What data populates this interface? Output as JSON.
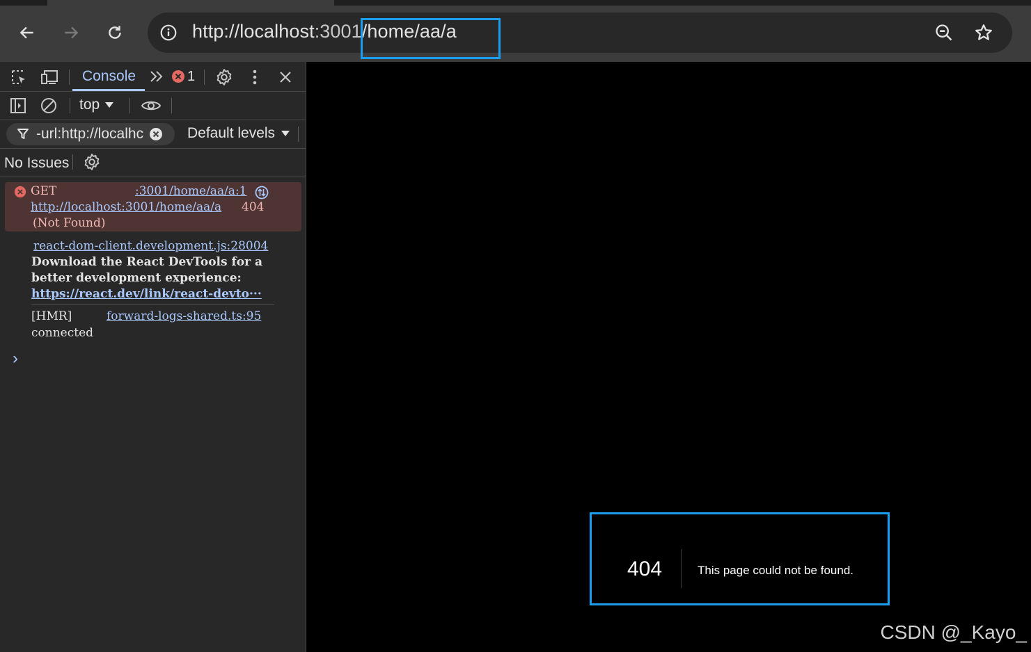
{
  "browser": {
    "url_host": "http://localhost",
    "url_port": ":3001",
    "url_path": "/home/aa/a"
  },
  "devtools": {
    "tabs": {
      "console": "Console",
      "error_count": "1"
    },
    "console_toolbar": {
      "context": "top"
    },
    "filter": {
      "value": "-url:http://localhc",
      "levels": "Default levels"
    },
    "issues": {
      "label": "No Issues"
    },
    "messages": [
      {
        "type": "error",
        "method": "GET",
        "source": ":3001/home/aa/a:1",
        "url": "http://localhost:3001/home/aa/a",
        "status": "404",
        "status_text": "(Not Found)"
      },
      {
        "type": "info",
        "source": "react-dom-client.development.js:28004",
        "line1": "Download the React DevTools for a",
        "line2": "better development experience:",
        "link": "https://react.dev/link/react-devto···"
      },
      {
        "type": "log",
        "prefix": "[HMR]",
        "source": "forward-logs-shared.ts:95",
        "text": "connected"
      }
    ],
    "prompt": "›"
  },
  "page": {
    "code": "404",
    "message": "This page could not be found."
  },
  "watermark": "CSDN @_Kayo_",
  "colors": {
    "accent": "#a8c7fa",
    "highlight": "#1a9ff0",
    "error": "#e46962",
    "error_bg": "#4e3534"
  },
  "icons": [
    "back-icon",
    "forward-icon",
    "reload-icon",
    "site-info-icon",
    "zoom-icon",
    "bookmark-star-icon",
    "inspect-element-icon",
    "device-toolbar-icon",
    "more-tabs-icon",
    "error-icon",
    "settings-icon",
    "kebab-menu-icon",
    "close-icon",
    "sidebar-toggle-icon",
    "clear-console-icon",
    "dropdown-arrow-icon",
    "live-expression-icon",
    "filter-icon",
    "clear-filter-icon",
    "network-request-icon",
    "prompt-chevron-icon"
  ]
}
